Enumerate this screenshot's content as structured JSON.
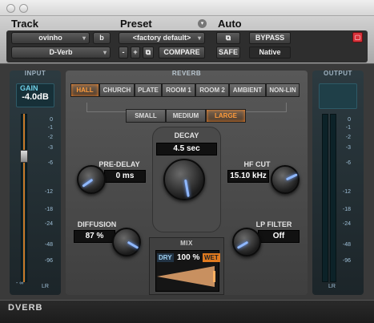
{
  "header": {
    "track_label": "Track",
    "preset_label": "Preset",
    "auto_label": "Auto",
    "track_name": "ovinho",
    "track_channel": "b",
    "plugin_name": "D-Verb",
    "preset_name": "<factory default>",
    "minus": "-",
    "plus": "+",
    "compare": "COMPARE",
    "bypass": "BYPASS",
    "safe": "SAFE",
    "native": "Native"
  },
  "input": {
    "label": "INPUT",
    "gain_label": "GAIN",
    "gain_value": "-4.0dB",
    "inf": "- ∞",
    "lr": "LR",
    "scale": [
      "0",
      "-1",
      "-2",
      "-3",
      "-6",
      "-12",
      "-18",
      "-24",
      "-48",
      "-96"
    ],
    "fader_fraction": 0.75
  },
  "output": {
    "label": "OUTPUT",
    "lr": "LR",
    "scale": [
      "0",
      "-1",
      "-2",
      "-3",
      "-6",
      "-12",
      "-18",
      "-24",
      "-48",
      "-96"
    ]
  },
  "reverb": {
    "label": "REVERB",
    "algorithms": [
      "HALL",
      "CHURCH",
      "PLATE",
      "ROOM 1",
      "ROOM 2",
      "AMBIENT",
      "NON-LIN"
    ],
    "selected_algorithm": "HALL",
    "sizes": [
      "SMALL",
      "MEDIUM",
      "LARGE"
    ],
    "selected_size": "LARGE"
  },
  "params": {
    "decay_label": "DECAY",
    "decay_value": "4.5 sec",
    "predelay_label": "PRE-DELAY",
    "predelay_value": "0 ms",
    "hfcut_label": "HF CUT",
    "hfcut_value": "15.10 kHz",
    "diffusion_label": "DIFFUSION",
    "diffusion_value": "87 %",
    "lpfilter_label": "LP FILTER",
    "lpfilter_value": "Off"
  },
  "mix": {
    "label": "MIX",
    "dry": "DRY",
    "value": "100 %",
    "wet": "WET",
    "percent": 100
  },
  "footer": {
    "name": "DVERB"
  },
  "colors": {
    "accent": "#ff9b3a",
    "bypass_red": "#d9323a",
    "knob_pointer": "#8fb8ff"
  }
}
